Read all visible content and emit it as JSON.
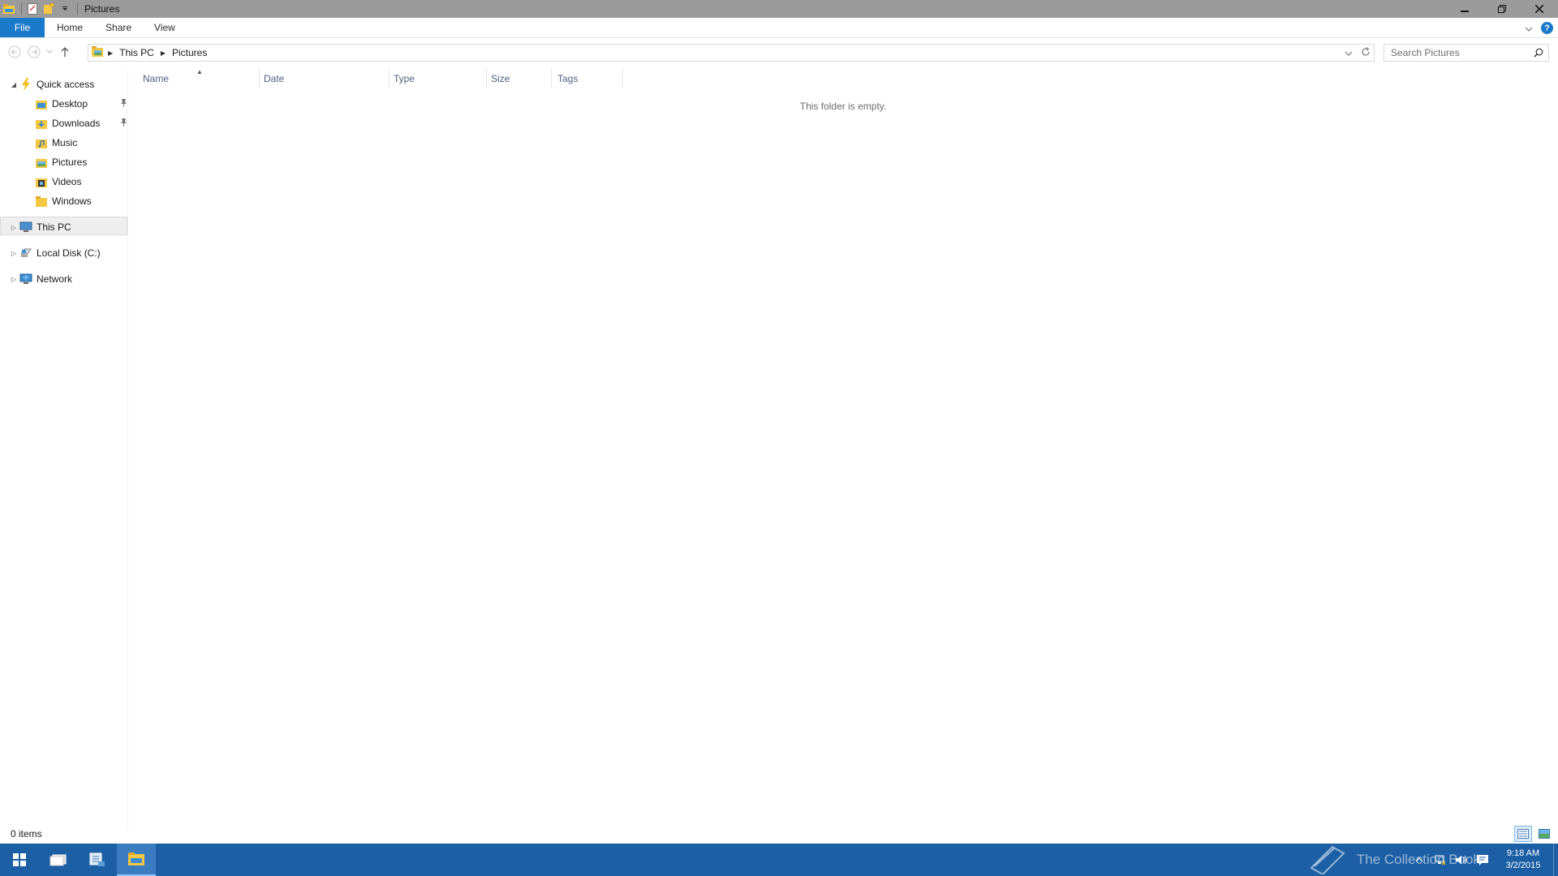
{
  "window": {
    "title": "Pictures",
    "minimize_glyph": "–",
    "maximize_glyph": "❐",
    "close_glyph": "✕"
  },
  "ribbon": {
    "tabs": [
      {
        "label": "File"
      },
      {
        "label": "Home"
      },
      {
        "label": "Share"
      },
      {
        "label": "View"
      }
    ],
    "help_glyph": "?"
  },
  "address": {
    "breadcrumbs": [
      "This PC",
      "Pictures"
    ],
    "search_placeholder": "Search Pictures"
  },
  "navpane": {
    "quick_access": "Quick access",
    "quick_items": [
      {
        "label": "Desktop",
        "pinned": true
      },
      {
        "label": "Downloads",
        "pinned": true
      },
      {
        "label": "Music"
      },
      {
        "label": "Pictures"
      },
      {
        "label": "Videos"
      },
      {
        "label": "Windows"
      }
    ],
    "this_pc": "This PC",
    "local_disk": "Local Disk (C:)",
    "network": "Network"
  },
  "content": {
    "columns": [
      "Name",
      "Date",
      "Type",
      "Size",
      "Tags"
    ],
    "empty_message": "This folder is empty."
  },
  "status": {
    "item_count": "0 items"
  },
  "taskbar": {
    "time": "9:18 AM",
    "date": "3/2/2015",
    "watermark_text": "The Collection Book"
  },
  "colors": {
    "file_tab": "#1979ca",
    "taskbar": "#1c5fa5",
    "titlebar": "#9b9b9b",
    "folder_yellow": "#f4c843"
  }
}
